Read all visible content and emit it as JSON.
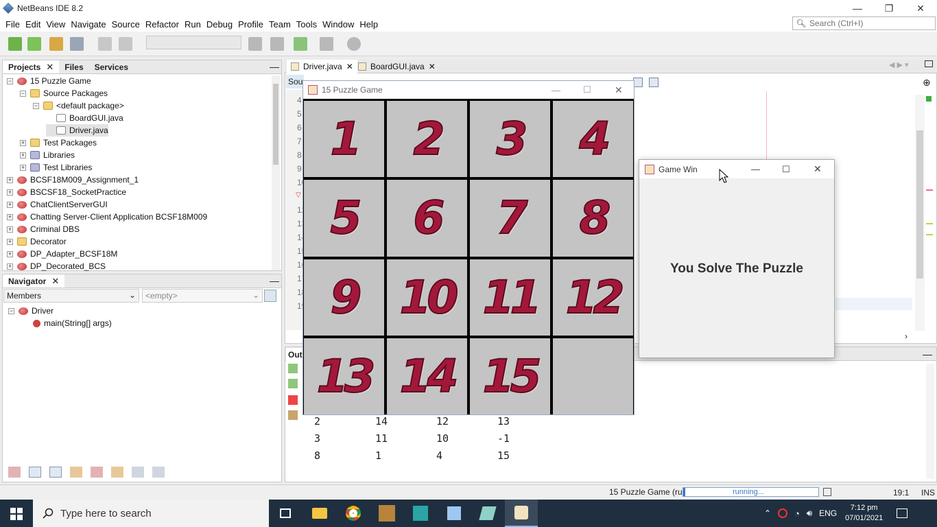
{
  "window": {
    "title": "NetBeans IDE 8.2"
  },
  "menu": [
    "File",
    "Edit",
    "View",
    "Navigate",
    "Source",
    "Refactor",
    "Run",
    "Debug",
    "Profile",
    "Team",
    "Tools",
    "Window",
    "Help"
  ],
  "search": {
    "placeholder": "Search (Ctrl+I)"
  },
  "projects_panel": {
    "tabs": [
      "Projects",
      "Files",
      "Services"
    ],
    "tree": [
      {
        "label": "15 Puzzle Game",
        "expander": "−",
        "icon": "project-icon"
      },
      {
        "label": "Source Packages",
        "expander": "−",
        "icon": "package-folder-icon"
      },
      {
        "label": "<default package>",
        "expander": "−",
        "icon": "package-icon"
      },
      {
        "label": "BoardGUI.java",
        "expander": "",
        "icon": "java-file-icon"
      },
      {
        "label": "Driver.java",
        "expander": "",
        "icon": "java-file-icon"
      },
      {
        "label": "Test Packages",
        "expander": "+",
        "icon": "package-folder-icon"
      },
      {
        "label": "Libraries",
        "expander": "+",
        "icon": "library-icon"
      },
      {
        "label": "Test Libraries",
        "expander": "+",
        "icon": "library-icon"
      },
      {
        "label": "BCSF18M009_Assignment_1",
        "expander": "+",
        "icon": "project-icon"
      },
      {
        "label": "BSCSF18_SocketPractice",
        "expander": "+",
        "icon": "project-icon"
      },
      {
        "label": "ChatClientServerGUI",
        "expander": "+",
        "icon": "project-icon"
      },
      {
        "label": "Chatting Server-Client Application BCSF18M009",
        "expander": "+",
        "icon": "project-icon"
      },
      {
        "label": "Criminal DBS",
        "expander": "+",
        "icon": "project-icon"
      },
      {
        "label": "Decorator",
        "expander": "+",
        "icon": "package-folder-icon"
      },
      {
        "label": "DP_Adapter_BCSF18M",
        "expander": "+",
        "icon": "project-icon"
      },
      {
        "label": "DP_Decorated_BCS",
        "expander": "+",
        "icon": "project-icon"
      }
    ]
  },
  "navigator": {
    "title": "Navigator",
    "members_label": "Members",
    "filter_placeholder": "<empty>",
    "class_name": "Driver",
    "method": "main(String[] args)"
  },
  "editor": {
    "tabs": [
      "Driver.java",
      "BoardGUI.java"
    ],
    "source_tab": "Sou",
    "line_numbers": [
      "4",
      "5",
      "6",
      "7",
      "8",
      "9",
      "10",
      "",
      "12",
      "13",
      "14",
      "15",
      "16",
      "17",
      "18",
      "19"
    ]
  },
  "output": {
    "tab": "Out",
    "lines": [
      [
        "2",
        "14",
        "12",
        "13"
      ],
      [
        "3",
        "11",
        "10",
        "-1"
      ],
      [
        "8",
        "1",
        "4",
        "15"
      ]
    ]
  },
  "puzzle": {
    "title": "15 Puzzle Game",
    "tiles": [
      "1",
      "2",
      "3",
      "4",
      "5",
      "6",
      "7",
      "8",
      "9",
      "10",
      "11",
      "12",
      "13",
      "14",
      "15",
      ""
    ]
  },
  "game_win": {
    "title": "Game Win",
    "message": "You Solve The Puzzle"
  },
  "status": {
    "task": "15 Puzzle Game (run)",
    "progress_text": "running...",
    "position": "19:1",
    "mode": "INS"
  },
  "taskbar": {
    "search_placeholder": "Type here to search",
    "language": "ENG",
    "time": "7:12 pm",
    "date": "07/01/2021"
  },
  "colors": {
    "tile_number": "#a3183a",
    "tile_bg": "#c4c4c4",
    "taskbar": "#1f2f3f"
  }
}
